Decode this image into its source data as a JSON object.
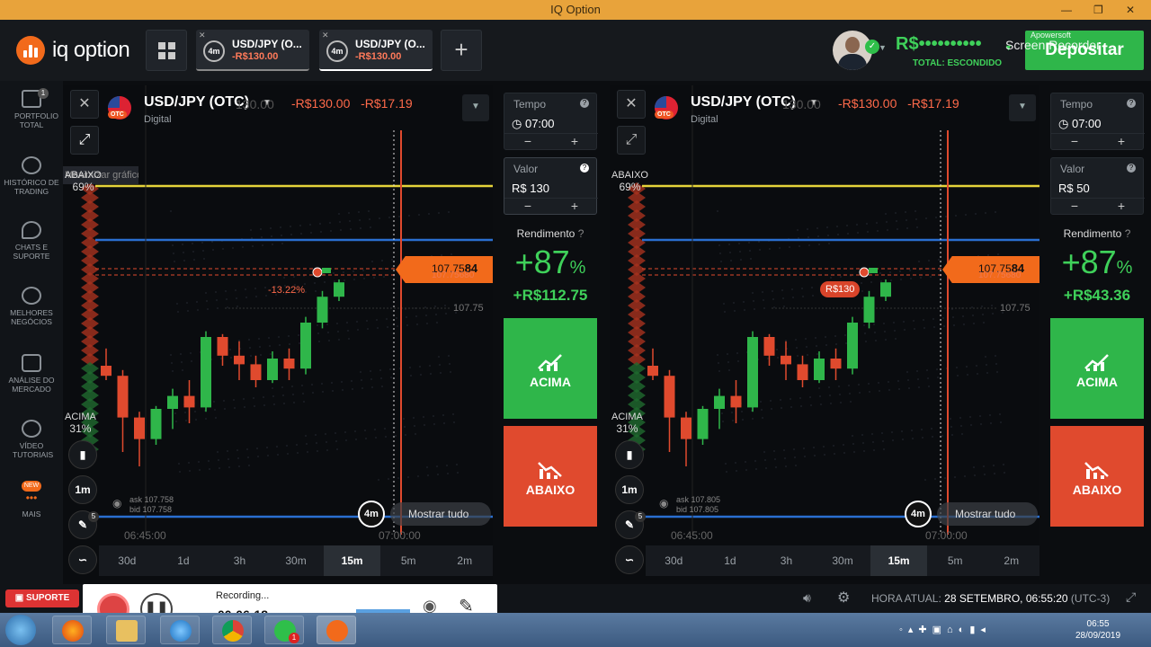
{
  "window": {
    "title": "IQ Option",
    "controls": [
      "—",
      "❐",
      "✕"
    ]
  },
  "header": {
    "logo_text": "iq option",
    "tabs": [
      {
        "badge": "4m",
        "pair": "USD/JPY (O...",
        "amount": "-R$130.00"
      },
      {
        "badge": "4m",
        "pair": "USD/JPY (O...",
        "amount": "-R$130.00"
      }
    ],
    "balance": "R$••••••••••",
    "balance_sub": "TOTAL: ESCONDIDO",
    "deposit_label": "Depositar",
    "recorder_watermark": "Screen Recorder",
    "recorder_brand": "Apowersoft"
  },
  "sidebar": {
    "items": [
      {
        "label": "PORTFOLIO TOTAL",
        "badge": "1"
      },
      {
        "label": "HISTÓRICO DE TRADING"
      },
      {
        "label": "CHATS E SUPORTE"
      },
      {
        "label": "MELHORES NEGÓCIOS"
      },
      {
        "label": "ANÁLISE DO MERCADO"
      },
      {
        "label": "VÍDEO TUTORIAIS"
      },
      {
        "label": "MAIS",
        "badge": "NEW"
      }
    ]
  },
  "left_panel": {
    "pair": "USD/JPY (OTC)",
    "pair_sub": "Digital",
    "price_a": "-R$130.00",
    "price_b": "-R$17.19",
    "ghost_price": "130.00",
    "tooltip": "Maximizar gráfico",
    "abaixo_label": "ABAIXO",
    "abaixo_pct": "69%",
    "acima_label": "ACIMA",
    "acima_pct": "31%",
    "current_price": "107.75",
    "current_price_bold": "84",
    "current_price_ghost": "107.75680",
    "level_label": "107.75",
    "trade_tag": "-13.22%",
    "ask": "ask 107.758",
    "bid": "bid 107.758",
    "time_left": "06:45:00",
    "time_right": "07:00:00",
    "expiry_badge": "4m",
    "show_all": "Mostrar tudo",
    "interval": "1m",
    "tools_badge": "5",
    "timeframes": [
      "30d",
      "1d",
      "3h",
      "30m",
      "15m",
      "5m",
      "2m"
    ],
    "active_timeframe": "15m",
    "tempo_label": "Tempo",
    "tempo_value": "07:00",
    "valor_label": "Valor",
    "valor_value": "R$ 130",
    "rendimento_label": "Rendimento",
    "yield_pct": "+87",
    "yield_sign": "%",
    "profit": "+R$112.75",
    "up_label": "ACIMA",
    "down_label": "ABAIXO"
  },
  "right_panel": {
    "pair": "USD/JPY (OTC)",
    "pair_sub": "Digital",
    "price_a": "-R$130.00",
    "price_b": "-R$17.19",
    "ghost_price": "130.00",
    "abaixo_label": "ABAIXO",
    "abaixo_pct": "69%",
    "acima_label": "ACIMA",
    "acima_pct": "31%",
    "current_price": "107.75",
    "current_price_bold": "84",
    "current_price_ghost": "107.75680",
    "level_label": "107.75",
    "trade_tag": "R$130",
    "ask": "ask 107.805",
    "bid": "bid 107.805",
    "time_left": "06:45:00",
    "time_right": "07:00:00",
    "expiry_badge": "4m",
    "show_all": "Mostrar tudo",
    "interval": "1m",
    "tools_badge": "5",
    "timeframes": [
      "30d",
      "1d",
      "3h",
      "30m",
      "15m",
      "5m",
      "2m"
    ],
    "active_timeframe": "15m",
    "tempo_label": "Tempo",
    "tempo_value": "07:00",
    "valor_label": "Valor",
    "valor_value": "R$ 50",
    "rendimento_label": "Rendimento",
    "yield_pct": "+87",
    "yield_sign": "%",
    "profit": "+R$43.36",
    "up_label": "ACIMA",
    "down_label": "ABAIXO"
  },
  "statusbar": {
    "support_label": "SUPORTE",
    "clock_label": "HORA ATUAL:",
    "clock_value": "28 SETEMBRO, 06:55:20",
    "timezone": "(UTC-3)"
  },
  "recorder": {
    "status": "Recording...",
    "elapsed": "00:06:18"
  },
  "taskbar": {
    "time": "06:55",
    "date": "28/09/2019",
    "whatsapp_badge": "1"
  },
  "colors": {
    "up": "#2fb64a",
    "down": "#e04a2e",
    "accent": "#f26a1b",
    "level_yellow": "#e6d43a",
    "level_blue": "#2a6fd0"
  },
  "candles": [
    {
      "o": 107.7,
      "h": 107.712,
      "l": 107.69,
      "c": 107.693
    },
    {
      "o": 107.693,
      "h": 107.697,
      "l": 107.64,
      "c": 107.664
    },
    {
      "o": 107.664,
      "h": 107.668,
      "l": 107.63,
      "c": 107.649
    },
    {
      "o": 107.649,
      "h": 107.672,
      "l": 107.645,
      "c": 107.67
    },
    {
      "o": 107.67,
      "h": 107.684,
      "l": 107.656,
      "c": 107.679
    },
    {
      "o": 107.679,
      "h": 107.69,
      "l": 107.66,
      "c": 107.671
    },
    {
      "o": 107.671,
      "h": 107.724,
      "l": 107.668,
      "c": 107.72
    },
    {
      "o": 107.72,
      "h": 107.722,
      "l": 107.7,
      "c": 107.707
    },
    {
      "o": 107.707,
      "h": 107.717,
      "l": 107.69,
      "c": 107.701
    },
    {
      "o": 107.701,
      "h": 107.707,
      "l": 107.685,
      "c": 107.69
    },
    {
      "o": 107.69,
      "h": 107.71,
      "l": 107.688,
      "c": 107.705
    },
    {
      "o": 107.705,
      "h": 107.712,
      "l": 107.69,
      "c": 107.698
    },
    {
      "o": 107.698,
      "h": 107.734,
      "l": 107.694,
      "c": 107.73
    },
    {
      "o": 107.73,
      "h": 107.752,
      "l": 107.726,
      "c": 107.748
    },
    {
      "o": 107.748,
      "h": 107.76,
      "l": 107.745,
      "c": 107.758
    }
  ]
}
